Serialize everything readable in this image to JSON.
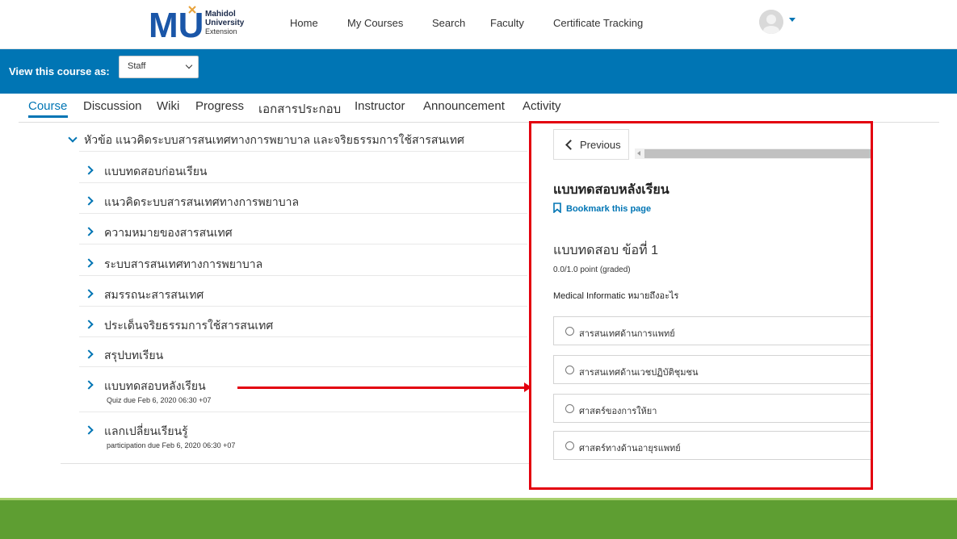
{
  "header": {
    "logo": {
      "brand": "MU",
      "line1": "Mahidol",
      "line2": "University",
      "line3": "Extension"
    },
    "nav": [
      "Home",
      "My Courses",
      "Search",
      "Faculty",
      "Certificate Tracking"
    ]
  },
  "view_bar": {
    "label": "View this course as:",
    "selected": "Staff"
  },
  "tabs": [
    "Course",
    "Discussion",
    "Wiki",
    "Progress",
    "เอกสารประกอบ",
    "Instructor",
    "Announcement",
    "Activity"
  ],
  "outline": {
    "section_title": "หัวข้อ แนวคิดระบบสารสนเทศทางการพยาบาล และจริยธรรมการใช้สารสนเทศ",
    "items": [
      {
        "label": "แบบทดสอบก่อนเรียน",
        "sub": ""
      },
      {
        "label": "แนวคิดระบบสารสนเทศทางการพยาบาล",
        "sub": ""
      },
      {
        "label": "ความหมายของสารสนเทศ",
        "sub": ""
      },
      {
        "label": "ระบบสารสนเทศทางการพยาบาล",
        "sub": ""
      },
      {
        "label": "สมรรถนะสารสนเทศ",
        "sub": ""
      },
      {
        "label": "ประเด็นจริยธรรมการใช้สารสนเทศ",
        "sub": ""
      },
      {
        "label": "สรุปบทเรียน",
        "sub": ""
      },
      {
        "label": "แบบทดสอบหลังเรียน",
        "sub": "Quiz due Feb 6, 2020 06:30 +07"
      },
      {
        "label": "แลกเปลี่ยนเรียนรู้",
        "sub": "participation due Feb 6, 2020 06:30 +07"
      }
    ]
  },
  "panel": {
    "previous_label": "Previous",
    "unit_title": "แบบทดสอบหลังเรียน",
    "bookmark_label": "Bookmark this page",
    "problem_title": "แบบทดสอบ ข้อที่ 1",
    "points": "0.0/1.0 point (graded)",
    "question": "Medical Informatic หมายถึงอะไร",
    "choices": [
      "สารสนเทศด้านการแพทย์",
      "สารสนเทศด้านเวชปฏิบัติชุมชน",
      "ศาสตร์ของการให้ยา",
      "ศาสตร์ทางด้านอายุรแพทย์"
    ]
  },
  "colors": {
    "primary_blue": "#0075b4",
    "annotation_red": "#e3000f",
    "footer_green": "#5e9e32",
    "footer_light_green": "#a6cf6b"
  }
}
